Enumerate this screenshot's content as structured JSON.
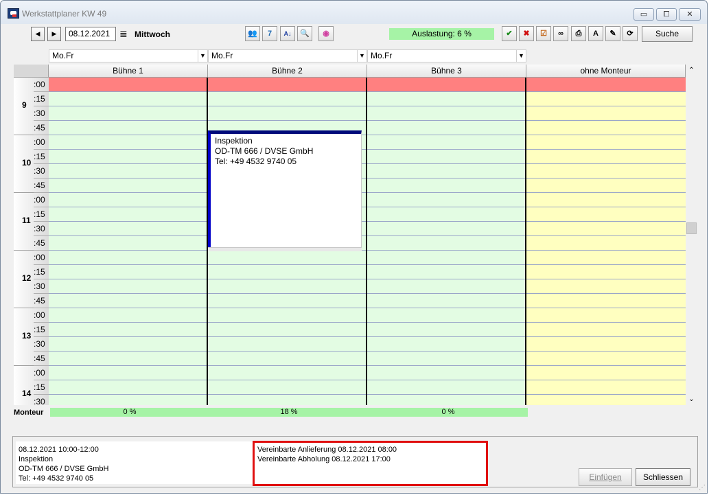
{
  "window": {
    "title": "Werkstattplaner KW 49",
    "min_glyph": "▭",
    "max_glyph": "⧠",
    "close_glyph": "✕"
  },
  "toolbar": {
    "prev_glyph": "◀",
    "next_glyph": "▶",
    "date": "08.12.2021",
    "weekday": "Mittwoch",
    "load": "Auslastung: 6 %",
    "search_label": "Suche",
    "icons": {
      "people": "👥",
      "calendar": "7",
      "sort": "A↓",
      "magnifier": "🔍",
      "color_wheel": "◉",
      "check": "✔",
      "delete": "✖",
      "checklist": "☑",
      "binoculars": "∞",
      "printer": "⎙",
      "text": "A",
      "pen": "✎",
      "refresh": "⟳",
      "menu": "≣"
    }
  },
  "filters": [
    "Mo.Fr",
    "Mo.Fr",
    "Mo.Fr"
  ],
  "columns": [
    "Bühne 1",
    "Bühne 2",
    "Bühne 3",
    "ohne Monteur"
  ],
  "colors": {
    "green": "#e3fce3",
    "yellow": "#ffffc0",
    "red": "#ff8080",
    "load_green": "#a6f3a6",
    "appointment_border": "#0000c8"
  },
  "hours": [
    {
      "hour": "9",
      "minutes": [
        ":00",
        ":15",
        ":30",
        ":45"
      ]
    },
    {
      "hour": "10",
      "minutes": [
        ":00",
        ":15",
        ":30",
        ":45"
      ]
    },
    {
      "hour": "11",
      "minutes": [
        ":00",
        ":15",
        ":30",
        ":45"
      ]
    },
    {
      "hour": "12",
      "minutes": [
        ":00",
        ":15",
        ":30",
        ":45"
      ]
    },
    {
      "hour": "13",
      "minutes": [
        ":00",
        ":15",
        ":30",
        ":45"
      ]
    },
    {
      "hour": "14",
      "minutes": [
        ":00",
        ":15",
        ":30"
      ]
    }
  ],
  "appointment": {
    "line1": "Inspektion",
    "line2": "OD-TM 666 / DVSE GmbH",
    "line3": "Tel: +49 4532 9740 05"
  },
  "monteur": {
    "label": "Monteur",
    "values": [
      "0 %",
      "18 %",
      "0 %"
    ]
  },
  "scrollbar": {
    "up_glyph": "⌃",
    "down_glyph": "⌄"
  },
  "info": {
    "line1": "08.12.2021 10:00-12:00",
    "line2": "Inspektion",
    "line3": "OD-TM 666 / DVSE GmbH",
    "line4": "Tel: +49 4532 9740 05"
  },
  "agreement": {
    "line1": "Vereinbarte Anlieferung 08.12.2021 08:00",
    "line2": "Vereinbarte Abholung 08.12.2021 17:00"
  },
  "buttons": {
    "insert": "Einfügen",
    "close": "Schliessen"
  }
}
